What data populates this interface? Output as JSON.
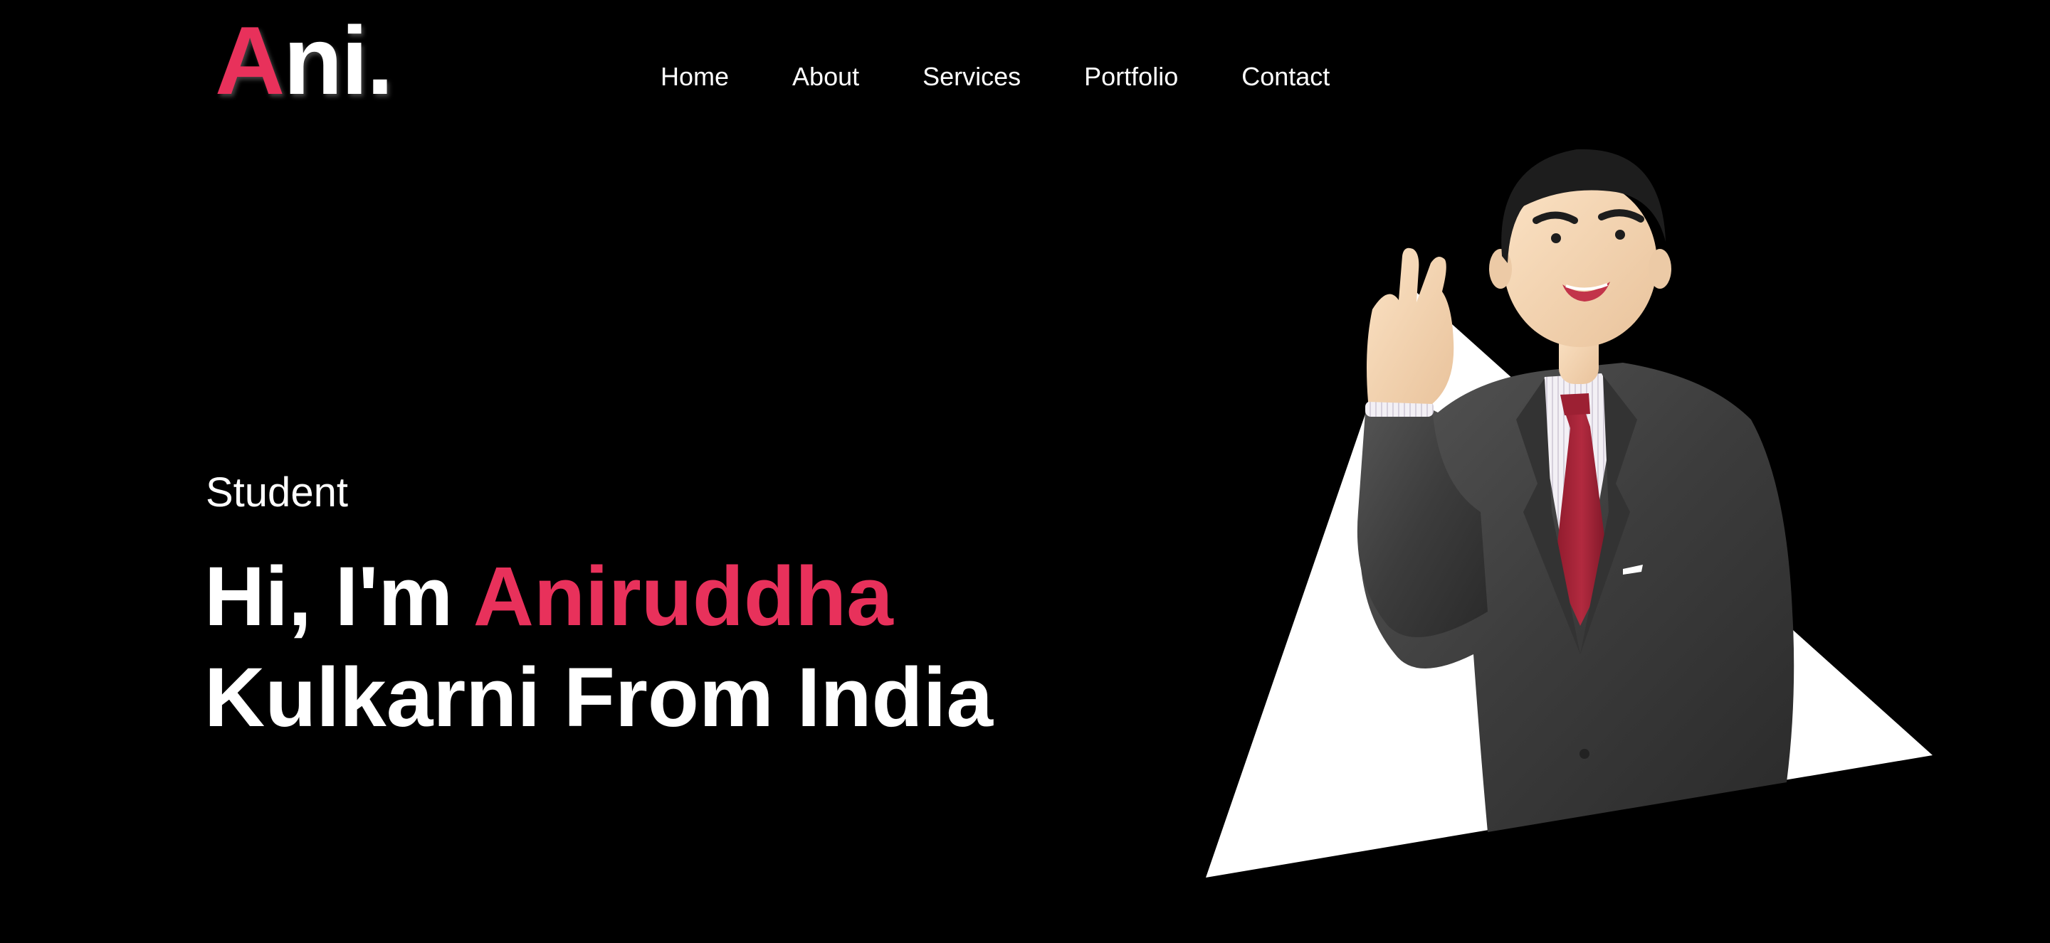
{
  "header": {
    "logo": {
      "first_letter": "A",
      "rest": "ni."
    },
    "nav": [
      {
        "label": "Home"
      },
      {
        "label": "About"
      },
      {
        "label": "Services"
      },
      {
        "label": "Portfolio"
      },
      {
        "label": "Contact"
      }
    ]
  },
  "hero": {
    "role": "Student",
    "headline": {
      "prefix": "Hi, I'm ",
      "name": "Aniruddha",
      "suffix": "Kulkarni From India"
    },
    "illustration": "3d-avatar-man-in-suit-waving"
  },
  "colors": {
    "background": "#000000",
    "accent": "#e8315b",
    "text": "#ffffff"
  }
}
